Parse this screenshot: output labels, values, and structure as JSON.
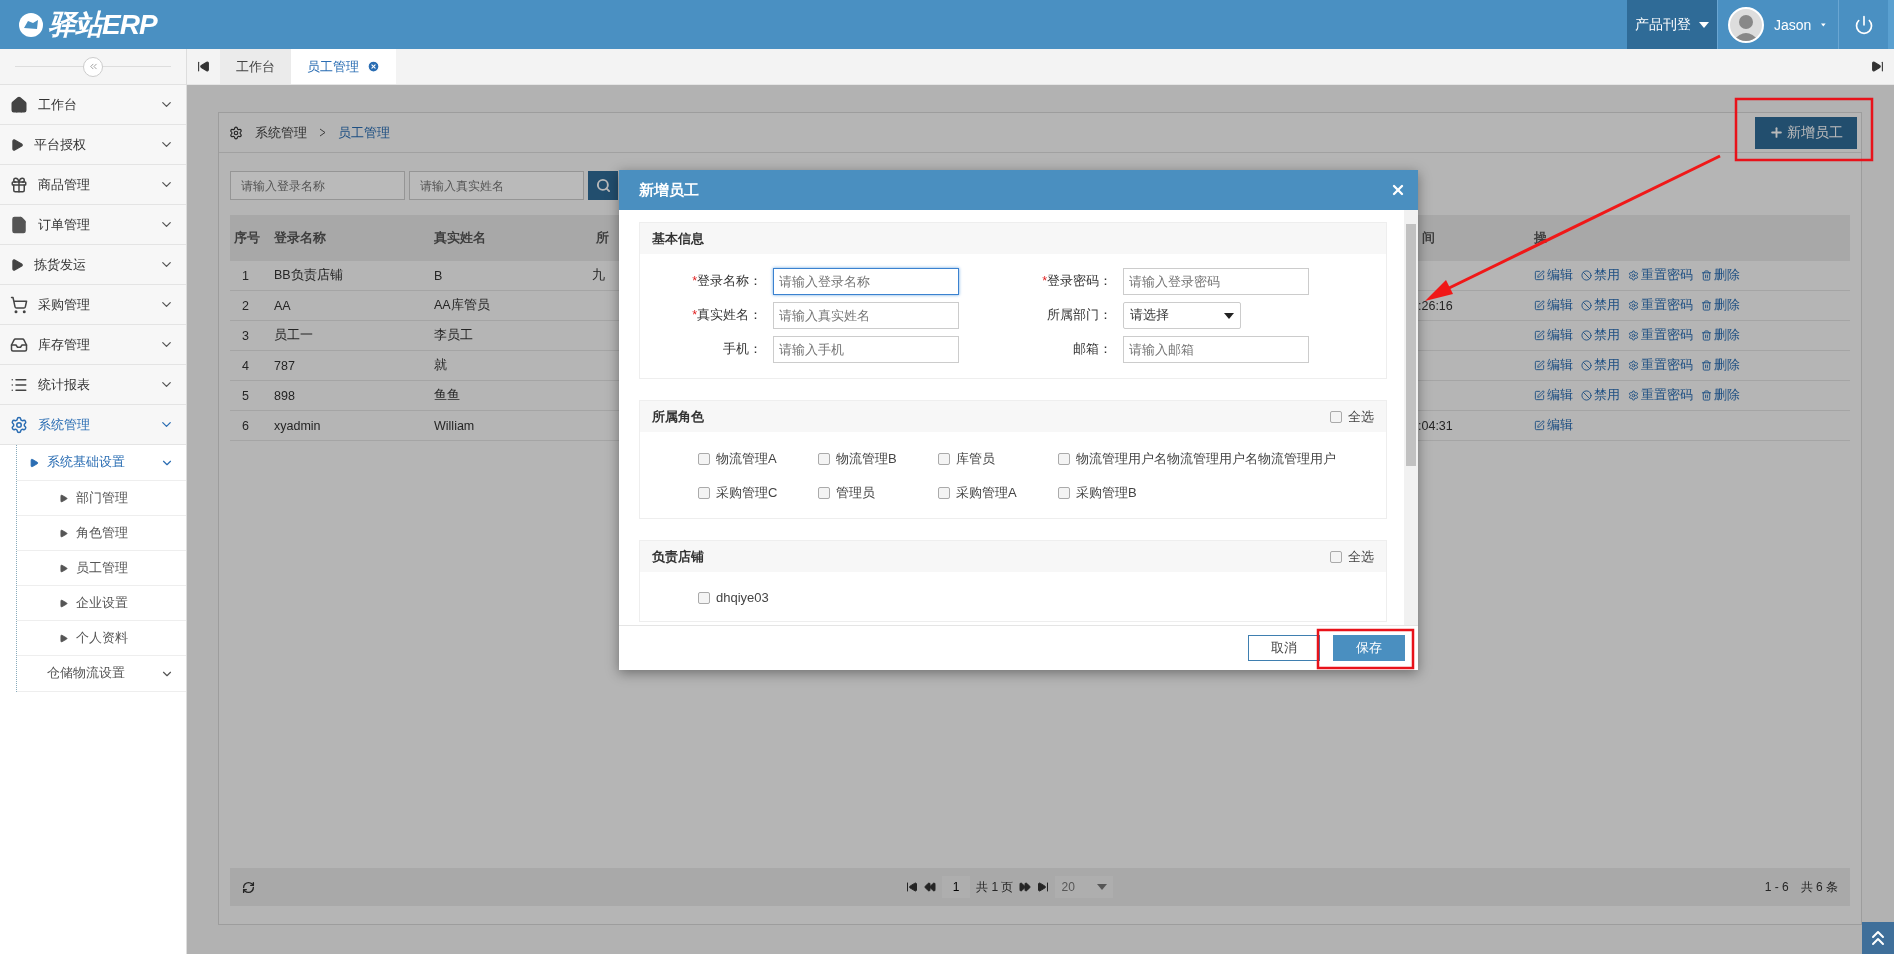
{
  "app": {
    "logo": "驿站ERP"
  },
  "header": {
    "menu": "产品刊登",
    "user": "Jason"
  },
  "tabs": [
    {
      "label": "工作台",
      "selected": false,
      "closable": false
    },
    {
      "label": "员工管理",
      "selected": true,
      "closable": true
    }
  ],
  "sidebar": {
    "items": [
      {
        "label": "工作台",
        "kind": "home",
        "selected": false
      },
      {
        "label": "平台授权",
        "kind": "caret",
        "selected": false
      },
      {
        "label": "商品管理",
        "kind": "gift",
        "selected": false
      },
      {
        "label": "订单管理",
        "kind": "file",
        "selected": false
      },
      {
        "label": "拣货发运",
        "kind": "caret",
        "selected": false
      },
      {
        "label": "采购管理",
        "kind": "cart",
        "selected": false
      },
      {
        "label": "库存管理",
        "kind": "inbox",
        "selected": false
      },
      {
        "label": "统计报表",
        "kind": "list",
        "selected": false
      },
      {
        "label": "系统管理",
        "kind": "gear",
        "selected": true,
        "children": [
          {
            "label": "系统基础设置",
            "selected": true,
            "children": [
              {
                "label": "部门管理",
                "selected": false
              },
              {
                "label": "角色管理",
                "selected": false
              },
              {
                "label": "员工管理",
                "selected": false
              },
              {
                "label": "企业设置",
                "selected": false
              },
              {
                "label": "个人资料",
                "selected": false
              }
            ]
          },
          {
            "label": "仓储物流设置",
            "selected": false
          }
        ]
      }
    ]
  },
  "breadcrumb": [
    "系统管理",
    "员工管理"
  ],
  "add_button": "新增员工",
  "filters": [
    {
      "placeholder": "请输入登录名称"
    },
    {
      "placeholder": "请输入真实姓名"
    }
  ],
  "table": {
    "columns": [
      "序号",
      "登录名称",
      "真实姓名",
      "所",
      "间",
      "操"
    ],
    "rows": [
      {
        "index": "1",
        "login": "BB负责店铺",
        "name": "B",
        "column_4": "九",
        "actions": [
          {
            "kind": "edit",
            "label": "编辑"
          },
          {
            "kind": "disable",
            "label": "禁用"
          },
          {
            "kind": "reset",
            "label": "重置密码"
          },
          {
            "kind": "delete",
            "label": "删除"
          }
        ]
      },
      {
        "index": "2",
        "login": "AA",
        "name": "AA库管员",
        "column_5": ":26:16",
        "actions": [
          {
            "kind": "edit",
            "label": "编辑"
          },
          {
            "kind": "disable",
            "label": "禁用"
          },
          {
            "kind": "reset",
            "label": "重置密码"
          },
          {
            "kind": "delete",
            "label": "删除"
          }
        ]
      },
      {
        "index": "3",
        "login": "员工一",
        "name": "李员工",
        "actions": [
          {
            "kind": "edit",
            "label": "编辑"
          },
          {
            "kind": "disable",
            "label": "禁用"
          },
          {
            "kind": "reset",
            "label": "重置密码"
          },
          {
            "kind": "delete",
            "label": "删除"
          }
        ]
      },
      {
        "index": "4",
        "login": "787",
        "name": "就",
        "actions": [
          {
            "kind": "edit",
            "label": "编辑"
          },
          {
            "kind": "disable",
            "label": "禁用"
          },
          {
            "kind": "reset",
            "label": "重置密码"
          },
          {
            "kind": "delete",
            "label": "删除"
          }
        ]
      },
      {
        "index": "5",
        "login": "898",
        "name": "鱼鱼",
        "actions": [
          {
            "kind": "edit",
            "label": "编辑"
          },
          {
            "kind": "disable",
            "label": "禁用"
          },
          {
            "kind": "reset",
            "label": "重置密码"
          },
          {
            "kind": "delete",
            "label": "删除"
          }
        ]
      },
      {
        "index": "6",
        "login": "xyadmin",
        "name": "William",
        "column_5": ":04:31",
        "actions": [
          {
            "kind": "edit",
            "label": "编辑"
          }
        ]
      }
    ]
  },
  "pager": {
    "page": "1",
    "total_pages": "共 1 页",
    "page_size": "20",
    "range": "1 - 6",
    "total": "共 6 条"
  },
  "dialog": {
    "title": "新增员工",
    "basic": {
      "title": "基本信息",
      "fields": [
        {
          "label": "登录名称：",
          "required_mark": "*",
          "kind": "input",
          "placeholder": "请输入登录名称",
          "focused": true
        },
        {
          "label": "登录密码：",
          "required_mark": "*",
          "kind": "input",
          "placeholder": "请输入登录密码"
        },
        {
          "label": "真实姓名：",
          "required_mark": "*",
          "kind": "input",
          "placeholder": "请输入真实姓名"
        },
        {
          "label": "所属部门：",
          "kind": "select",
          "value": "请选择"
        },
        {
          "label": "手机：",
          "kind": "input",
          "placeholder": "请输入手机"
        },
        {
          "label": "邮箱：",
          "kind": "input",
          "placeholder": "请输入邮箱"
        }
      ]
    },
    "roles": {
      "title": "所属角色",
      "select_all": {
        "label": "全选",
        "checked": false
      },
      "items": [
        {
          "label": "物流管理A",
          "checked": false
        },
        {
          "label": "物流管理B",
          "checked": false
        },
        {
          "label": "库管员",
          "checked": false
        },
        {
          "label": "物流管理用户名物流管理用户名物流管理用户",
          "checked": false
        },
        {
          "label": "采购管理C",
          "checked": false
        },
        {
          "label": "管理员",
          "checked": false
        },
        {
          "label": "采购管理A",
          "checked": false
        },
        {
          "label": "采购管理B",
          "checked": false
        }
      ]
    },
    "stores": {
      "title": "负责店铺",
      "select_all": {
        "label": "全选",
        "checked": false
      },
      "items": [
        {
          "label": "dhqiye03",
          "checked": false
        }
      ]
    },
    "buttons": [
      {
        "kind": "secondary",
        "label": "取消"
      },
      {
        "kind": "primary",
        "label": "保存"
      }
    ]
  }
}
